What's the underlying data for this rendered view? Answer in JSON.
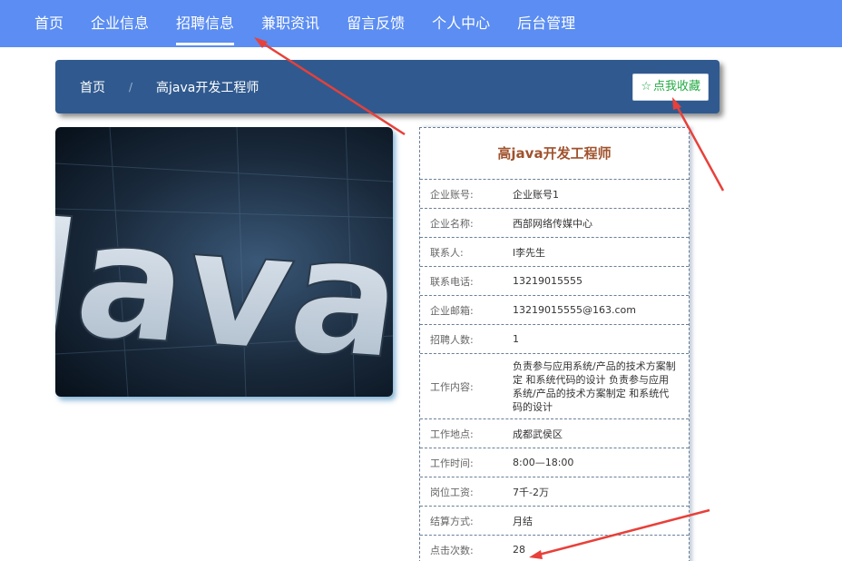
{
  "nav": {
    "items": [
      {
        "label": "首页"
      },
      {
        "label": "企业信息"
      },
      {
        "label": "招聘信息"
      },
      {
        "label": "兼职资讯"
      },
      {
        "label": "留言反馈"
      },
      {
        "label": "个人中心"
      },
      {
        "label": "后台管理"
      }
    ],
    "active": "招聘信息"
  },
  "breadcrumb": {
    "home": "首页",
    "separator": "/",
    "current": "高java开发工程师"
  },
  "favorite_button": {
    "icon": "star-outline-icon",
    "label": "点我收藏"
  },
  "image": {
    "text": "Java"
  },
  "detail": {
    "title": "高java开发工程师",
    "rows": [
      {
        "label": "企业账号:",
        "value": "企业账号1"
      },
      {
        "label": "企业名称:",
        "value": "西部网络传媒中心"
      },
      {
        "label": "联系人:",
        "value": "l李先生"
      },
      {
        "label": "联系电话:",
        "value": "13219015555"
      },
      {
        "label": "企业邮箱:",
        "value": "13219015555@163.com"
      },
      {
        "label": "招聘人数:",
        "value": "1"
      },
      {
        "label": "工作内容:",
        "value": "负责参与应用系统/产品的技术方案制定 和系统代码的设计 负责参与应用系统/产品的技术方案制定 和系统代码的设计"
      },
      {
        "label": "工作地点:",
        "value": "成都武侯区"
      },
      {
        "label": "工作时间:",
        "value": "8:00—18:00"
      },
      {
        "label": "岗位工资:",
        "value": "7千-2万"
      },
      {
        "label": "结算方式:",
        "value": "月结"
      },
      {
        "label": "点击次数:",
        "value": "28"
      }
    ]
  },
  "colors": {
    "nav_bg": "#5b8df2",
    "breadcrumb_bg": "#305a8f",
    "title_color": "#a0522d",
    "favorite_color": "#22aa44",
    "annotation_arrow": "#e8403a"
  }
}
